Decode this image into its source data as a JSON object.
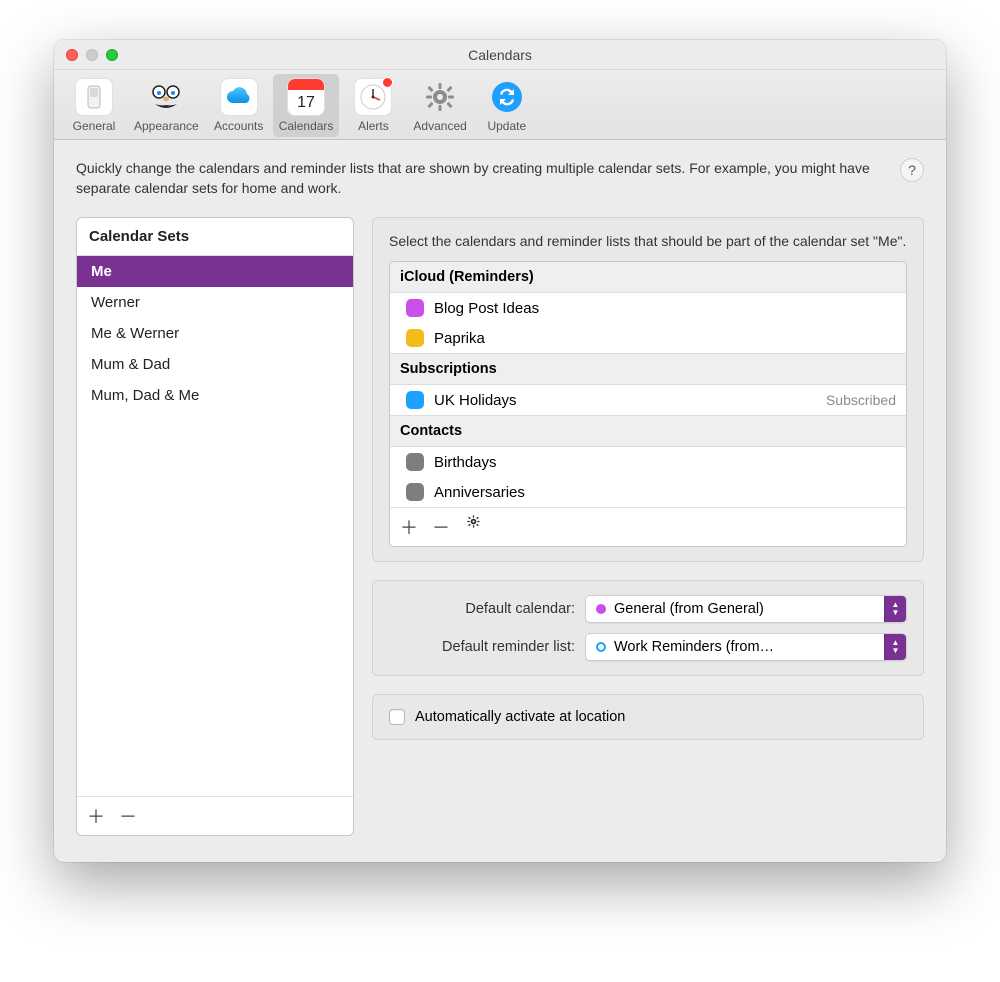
{
  "window": {
    "title": "Calendars"
  },
  "toolbar": {
    "items": [
      {
        "label": "General"
      },
      {
        "label": "Appearance"
      },
      {
        "label": "Accounts"
      },
      {
        "label": "Calendars",
        "active": true
      },
      {
        "label": "Alerts"
      },
      {
        "label": "Advanced"
      },
      {
        "label": "Update"
      }
    ]
  },
  "help": {
    "label": "?"
  },
  "description": "Quickly change the calendars and reminder lists that are shown by creating multiple calendar sets. For example, you might have separate calendar sets for home and work.",
  "sets": {
    "header": "Calendar Sets",
    "items": [
      "Me",
      "Werner",
      "Me & Werner",
      "Mum & Dad",
      "Mum, Dad & Me"
    ],
    "selected_index": 0
  },
  "right": {
    "hint": "Select the calendars and reminder lists that should be part of the calendar set \"Me\".",
    "groups": [
      {
        "name": "iCloud (Reminders)",
        "items": [
          {
            "name": "Blog Post Ideas",
            "color": "#c94fe8"
          },
          {
            "name": "Paprika",
            "color": "#f2bc1b"
          }
        ]
      },
      {
        "name": "Subscriptions",
        "items": [
          {
            "name": "UK Holidays",
            "color": "#1ea0ff",
            "badge": "Subscribed"
          }
        ]
      },
      {
        "name": "Contacts",
        "items": [
          {
            "name": "Birthdays",
            "color": "#7e7e7e"
          },
          {
            "name": "Anniversaries",
            "color": "#7e7e7e"
          }
        ]
      }
    ]
  },
  "defaults": {
    "cal_label": "Default calendar:",
    "cal_value": "General (from General)",
    "cal_dot": "#c94fe8",
    "rem_label": "Default reminder list:",
    "rem_value": "Work Reminders (from…"
  },
  "auto": {
    "label": "Automatically activate at location"
  },
  "icons": {
    "calendar_day": "17"
  }
}
